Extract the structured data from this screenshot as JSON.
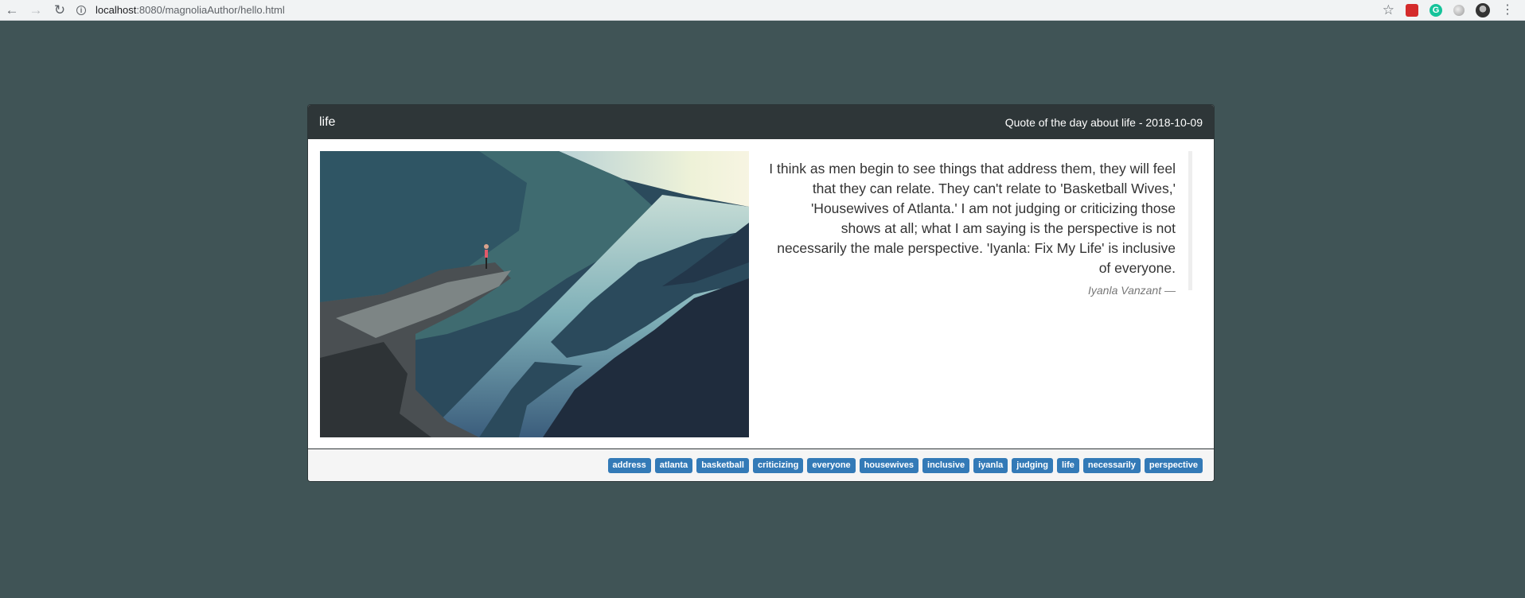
{
  "browser": {
    "url_host": "localhost",
    "url_rest": ":8080/magnoliaAuthor/hello.html",
    "icons": [
      "back-arrow-icon",
      "forward-arrow-icon",
      "reload-icon",
      "info-icon",
      "star-icon",
      "extension-red-icon",
      "grammarly-icon",
      "extension-grey-icon",
      "profile-avatar-icon",
      "menu-dots-icon"
    ]
  },
  "panel": {
    "title": "life",
    "subtitle": "Quote of the day about life - 2018-10-09"
  },
  "quote": {
    "text": "I think as men begin to see things that address them, they will feel that they can relate. They can't relate to 'Basketball Wives,' 'Housewives of Atlanta.' I am not judging or criticizing those shows at all; what I am saying is the perspective is not necessarily the male perspective. 'Iyanla: Fix My Life' is inclusive of everyone.",
    "author": "Iyanla Vanzant —"
  },
  "tags": [
    "address",
    "atlanta",
    "basketball",
    "criticizing",
    "everyone",
    "housewives",
    "inclusive",
    "iyanla",
    "judging",
    "life",
    "necessarily",
    "perspective"
  ],
  "colors": {
    "background": "#405456",
    "panel_heading": "#2e3638",
    "tag": "#337ab7"
  }
}
